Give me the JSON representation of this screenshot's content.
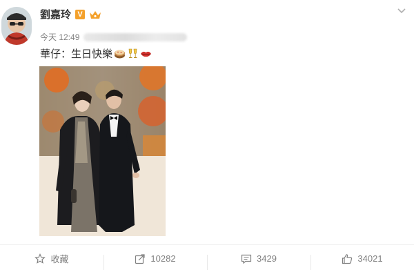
{
  "post": {
    "username": "劉嘉玲",
    "verified_badge": "V",
    "time": "今天 12:49",
    "text": "華仔：生日快樂",
    "emojis": [
      "cake-emoji",
      "cheers-emoji",
      "lips-emoji"
    ]
  },
  "actions": {
    "favorite_label": "收藏",
    "share_count": "10282",
    "comment_count": "3429",
    "like_count": "34021"
  },
  "colors": {
    "accent": "#f4a12b",
    "text": "#333333",
    "muted": "#808080"
  }
}
